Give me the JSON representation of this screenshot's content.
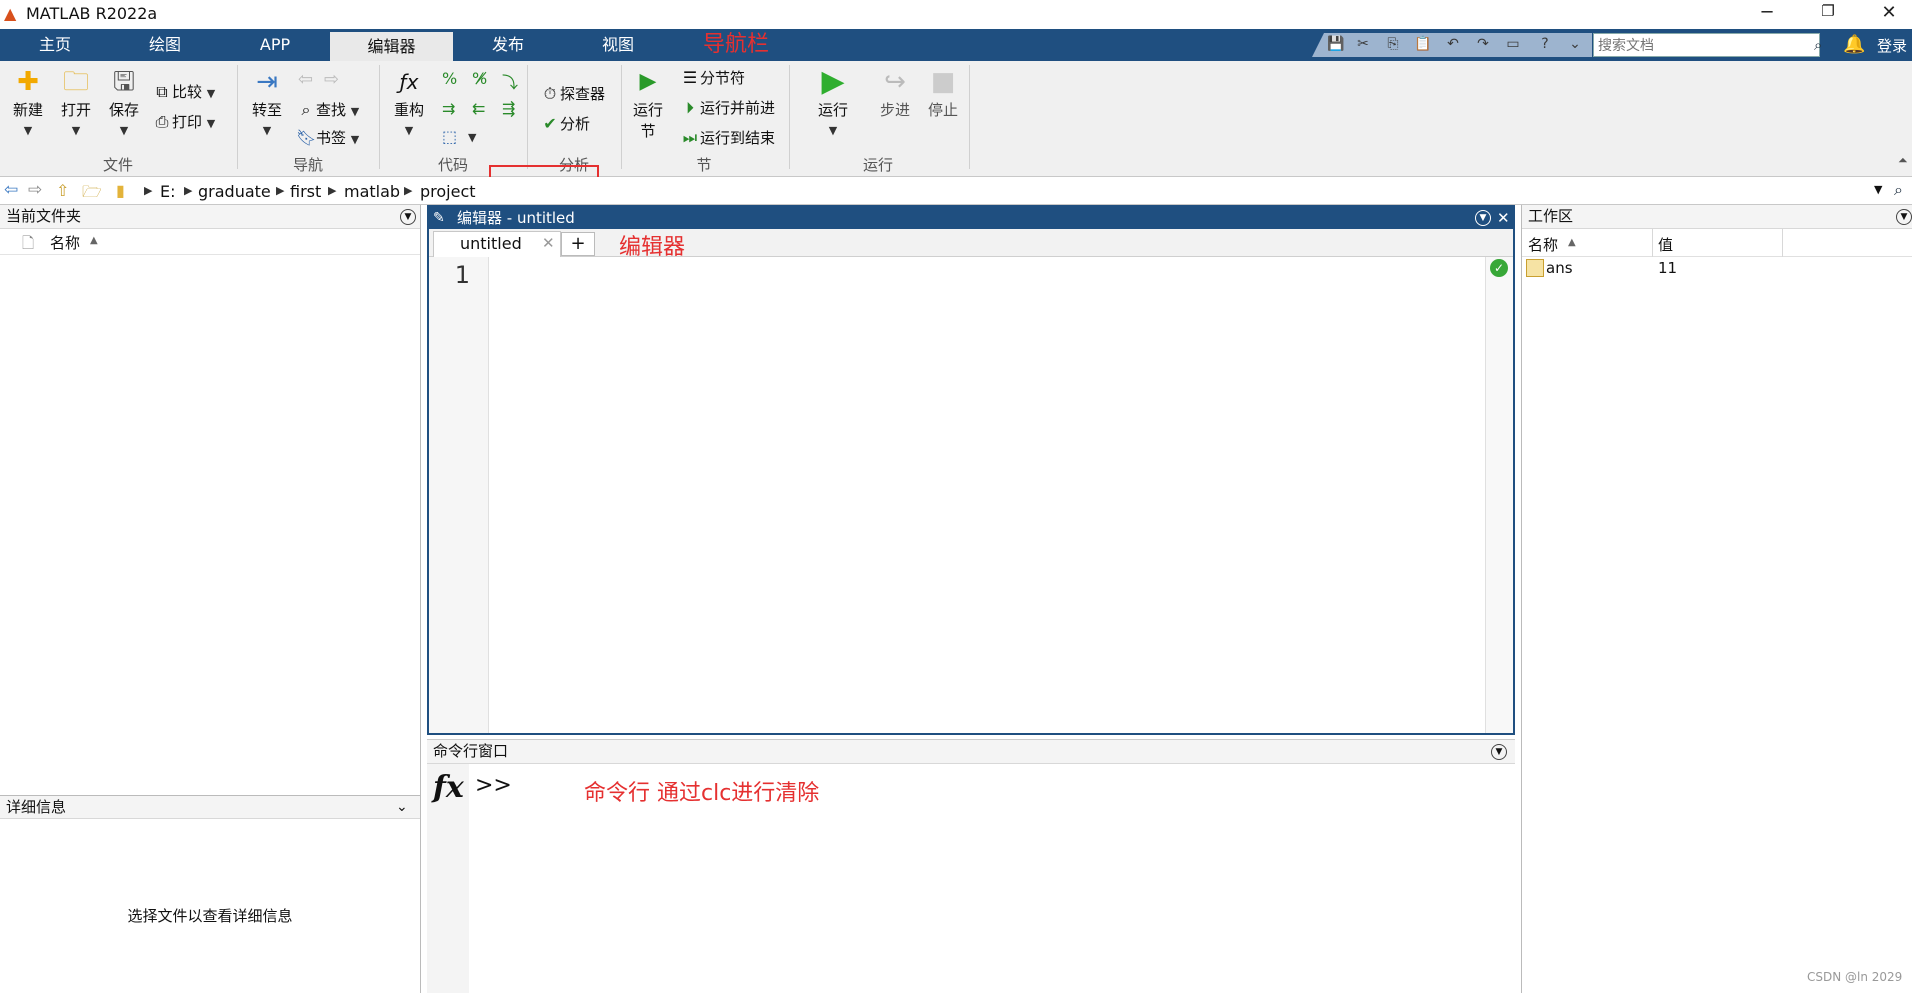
{
  "window": {
    "title": "MATLAB R2022a",
    "min_symbol": "─",
    "restore_symbol": "❐",
    "close_symbol": "✕"
  },
  "nav": {
    "tabs": [
      "主页",
      "绘图",
      "APP",
      "编辑器",
      "发布",
      "视图"
    ],
    "active_index": 3,
    "annotation": "导航栏",
    "search_placeholder": "搜索文档",
    "login": "登录"
  },
  "ribbon": {
    "file": {
      "new": "新建",
      "open": "打开",
      "save": "保存",
      "compare": "比较",
      "print": "打印",
      "group": "文件"
    },
    "navigate": {
      "goto": "转至",
      "find": "查找",
      "bookmark": "书签",
      "group": "导航"
    },
    "code": {
      "refactor": "重构",
      "group": "代码"
    },
    "analyze": {
      "profiler": "探查器",
      "analyze": "分析",
      "group": "分析"
    },
    "section": {
      "run_section_1": "运行",
      "run_section_2": "节",
      "section_break": "分节符",
      "run_advance": "运行并前进",
      "run_to_end": "运行到结束",
      "group": "节"
    },
    "run": {
      "run": "运行",
      "step": "步进",
      "stop": "停止",
      "group": "运行"
    }
  },
  "address": {
    "path": [
      "E:",
      "graduate",
      "first",
      "matlab",
      "project"
    ]
  },
  "left_panel": {
    "title": "当前文件夹",
    "col_name": "名称",
    "details_title": "详细信息",
    "details_placeholder": "选择文件以查看详细信息"
  },
  "editor": {
    "title": "编辑器 - untitled",
    "tab": "untitled",
    "add_tab": "+",
    "annotation": "编辑器",
    "line_numbers": [
      "1"
    ]
  },
  "command": {
    "title": "命令行窗口",
    "fx": "fx",
    "prompt": ">>",
    "annotation": "命令行 通过clc进行清除"
  },
  "workspace": {
    "title": "工作区",
    "col_name": "名称",
    "col_value": "值",
    "rows": [
      {
        "name": "ans",
        "value": "11"
      }
    ]
  },
  "watermark": "CSDN @ln 2029",
  "colors": {
    "nav_bg": "#1f4f80",
    "annotation": "#e53030",
    "ribbon_bg": "#f0f0f0"
  }
}
